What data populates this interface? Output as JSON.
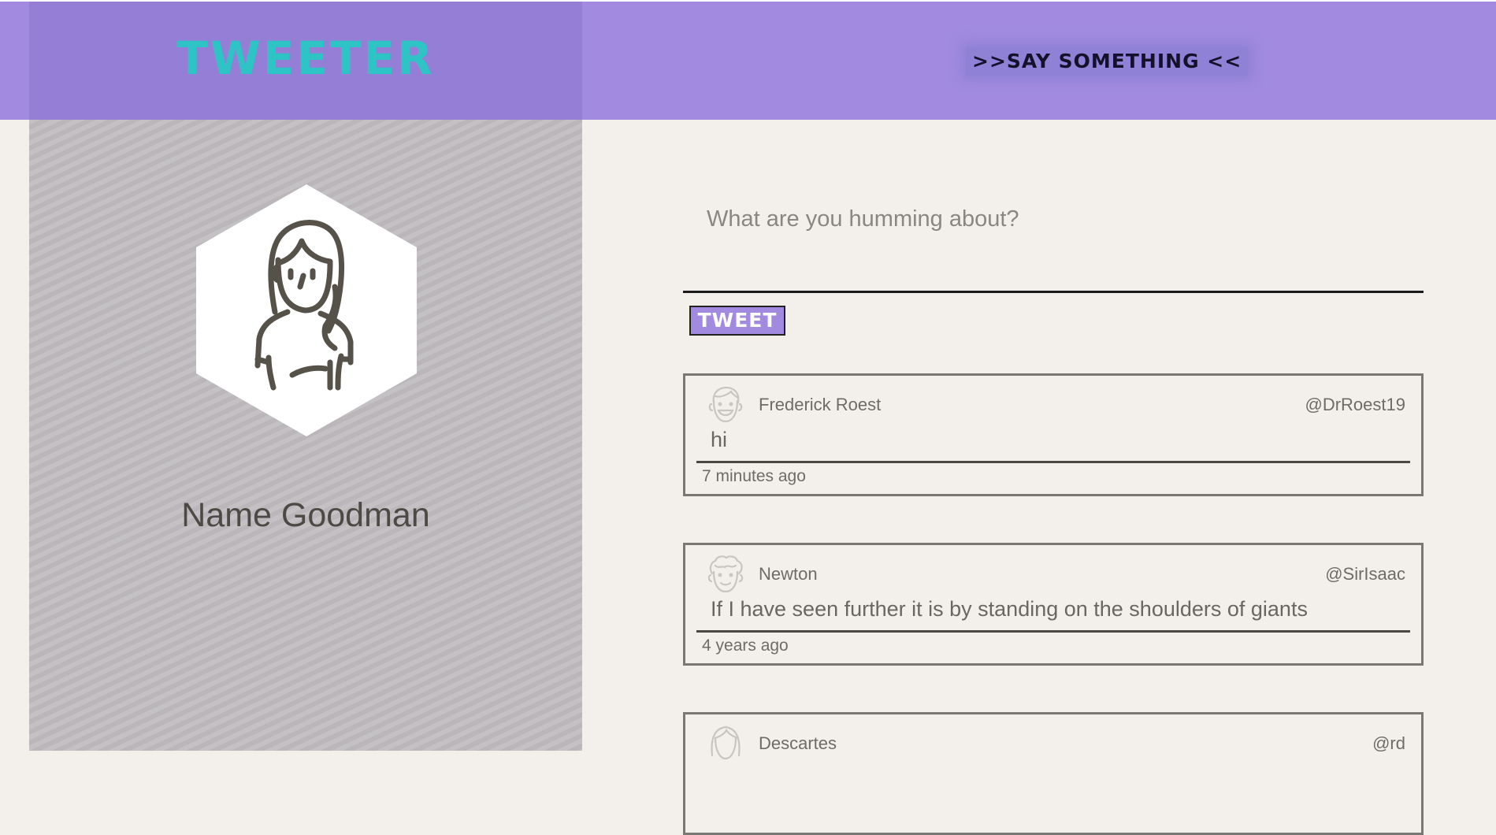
{
  "header": {
    "logo": "Tweeter",
    "tagline": ">>Say Something <<"
  },
  "profile": {
    "name": "Name Goodman",
    "avatar_icon": "woman-avatar-icon"
  },
  "composer": {
    "placeholder": "What are you humming about?",
    "button_label": "Tweet"
  },
  "tweets": [
    {
      "user": "Frederick Roest",
      "handle": "@DrRoest19",
      "text": "hi",
      "time": "7 minutes ago",
      "avatar_icon": "smiling-man-avatar-icon"
    },
    {
      "user": "Newton",
      "handle": "@SirIsaac",
      "text": "If I have seen further it is by standing on the shoulders of giants",
      "time": "4 years ago",
      "avatar_icon": "curly-hair-man-avatar-icon"
    },
    {
      "user": "Descartes",
      "handle": "@rd",
      "text": "",
      "time": "",
      "avatar_icon": "long-hair-avatar-icon"
    }
  ],
  "colors": {
    "header_bg": "#a18ae0",
    "header_left_bg": "#957fd6",
    "logo": "#2ec4c6",
    "sidebar_bg": "#c0bcc0",
    "page_bg": "#f3f0ec",
    "button_bg": "#a18ae0"
  }
}
